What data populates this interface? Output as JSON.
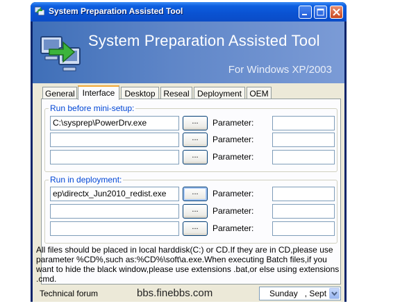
{
  "window": {
    "title": "System Preparation Assisted Tool"
  },
  "banner": {
    "title": "System Preparation Assisted Tool",
    "subtitle": "For Windows XP/2003"
  },
  "tabs": [
    {
      "label": "General",
      "active": false
    },
    {
      "label": "Interface",
      "active": true
    },
    {
      "label": "Desktop",
      "active": false
    },
    {
      "label": "Reseal",
      "active": false
    },
    {
      "label": "Deployment",
      "active": false
    },
    {
      "label": "OEM",
      "active": false
    }
  ],
  "groups": {
    "before_mini_setup": {
      "label": "Run before mini-setup:",
      "rows": [
        {
          "path": "C:\\sysprep\\PowerDrv.exe",
          "browse": "...",
          "param_label": "Parameter:",
          "param_value": ""
        },
        {
          "path": "",
          "browse": "...",
          "param_label": "Parameter:",
          "param_value": ""
        },
        {
          "path": "",
          "browse": "...",
          "param_label": "Parameter:",
          "param_value": ""
        }
      ]
    },
    "deployment": {
      "label": "Run in deployment:",
      "rows": [
        {
          "path": "ep\\directx_Jun2010_redist.exe",
          "browse": "...",
          "param_label": "Parameter:",
          "param_value": ""
        },
        {
          "path": "",
          "browse": "...",
          "param_label": "Parameter:",
          "param_value": ""
        },
        {
          "path": "",
          "browse": "...",
          "param_label": "Parameter:",
          "param_value": ""
        }
      ]
    }
  },
  "note": "All files should be placed in local harddisk(C:) or CD.If they are in CD,please use parameter %CD%,such as:%CD%\\soft\\a.exe.When executing Batch files,if you want to hide the black window,please use extensions .bat,or else using  extensions .cmd.",
  "status": {
    "left": "Technical forum",
    "url": "bbs.finebbs.com",
    "date_value": "Sunday   , Sept"
  },
  "icons": [
    "app-icon",
    "minimize-icon",
    "maximize-icon",
    "close-icon",
    "computers-arrow-icon",
    "chevron-down-icon"
  ],
  "colors": {
    "titlebar": "#0a52d1",
    "banner": "#5f86c8",
    "group_label": "#0046d5",
    "active_tab_accent": "#f2a733"
  }
}
